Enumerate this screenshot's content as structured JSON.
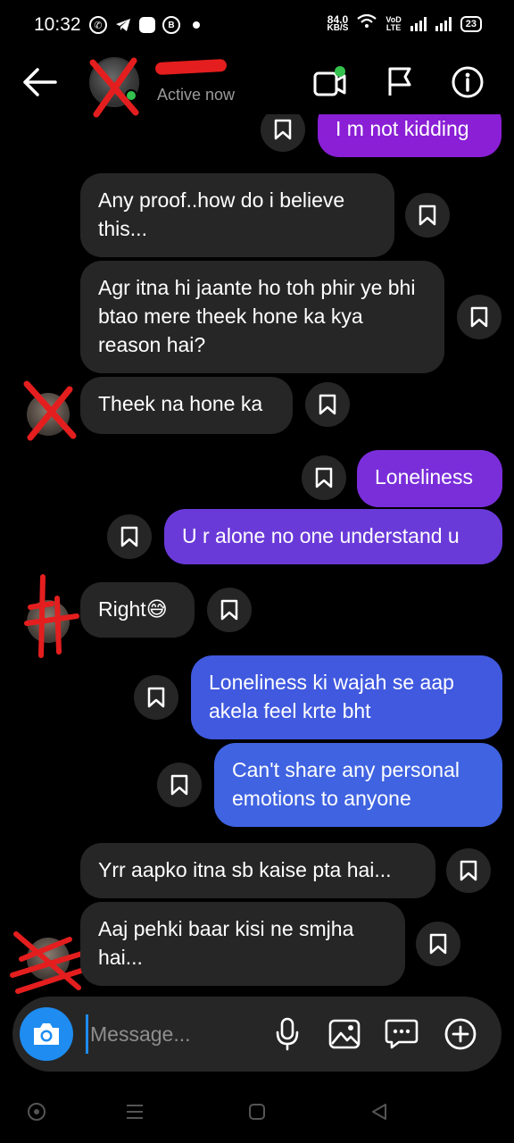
{
  "status_bar": {
    "time": "10:32",
    "net_speed_value": "84.0",
    "net_speed_unit": "KB/S",
    "volte_top": "VoD",
    "volte_bottom": "LTE",
    "battery": "23"
  },
  "header": {
    "status": "Active now",
    "icons": [
      "back-arrow-icon",
      "video-call-icon",
      "flag-icon",
      "info-icon"
    ]
  },
  "messages": [
    {
      "id": 1,
      "side": "out",
      "text": "I m not kidding"
    },
    {
      "id": 2,
      "side": "in",
      "text": "Any proof..how do i believe this..."
    },
    {
      "id": 3,
      "side": "in",
      "text": "Agr itna hi jaante ho toh phir ye bhi btao mere theek hone ka kya reason hai?"
    },
    {
      "id": 4,
      "side": "in",
      "text": "Theek na hone ka"
    },
    {
      "id": 5,
      "side": "out",
      "text": "Loneliness"
    },
    {
      "id": 6,
      "side": "out",
      "text": "U r alone no one understand u"
    },
    {
      "id": 7,
      "side": "in",
      "text": "Right😅"
    },
    {
      "id": 8,
      "side": "out",
      "text": "Loneliness ki wajah se aap akela feel krte bht"
    },
    {
      "id": 9,
      "side": "out",
      "text": "Can't share any personal emotions to anyone"
    },
    {
      "id": 10,
      "side": "in",
      "text": "Yrr aapko itna sb kaise pta hai..."
    },
    {
      "id": 11,
      "side": "in",
      "text": "Aaj pehki baar kisi ne smjha hai..."
    }
  ],
  "composer": {
    "placeholder": "Message...",
    "icons": [
      "camera-icon",
      "microphone-icon",
      "gallery-icon",
      "sticker-icon",
      "plus-icon"
    ]
  },
  "colors": {
    "background": "#000000",
    "incoming_bubble": "#262626",
    "outgoing_purple": "#8a1fd6",
    "outgoing_violet": "#6a3ad9",
    "outgoing_blue": "#4059df",
    "camera_button": "#1e8cf1",
    "online_dot": "#33c24d",
    "redaction": "#e41e1e"
  }
}
